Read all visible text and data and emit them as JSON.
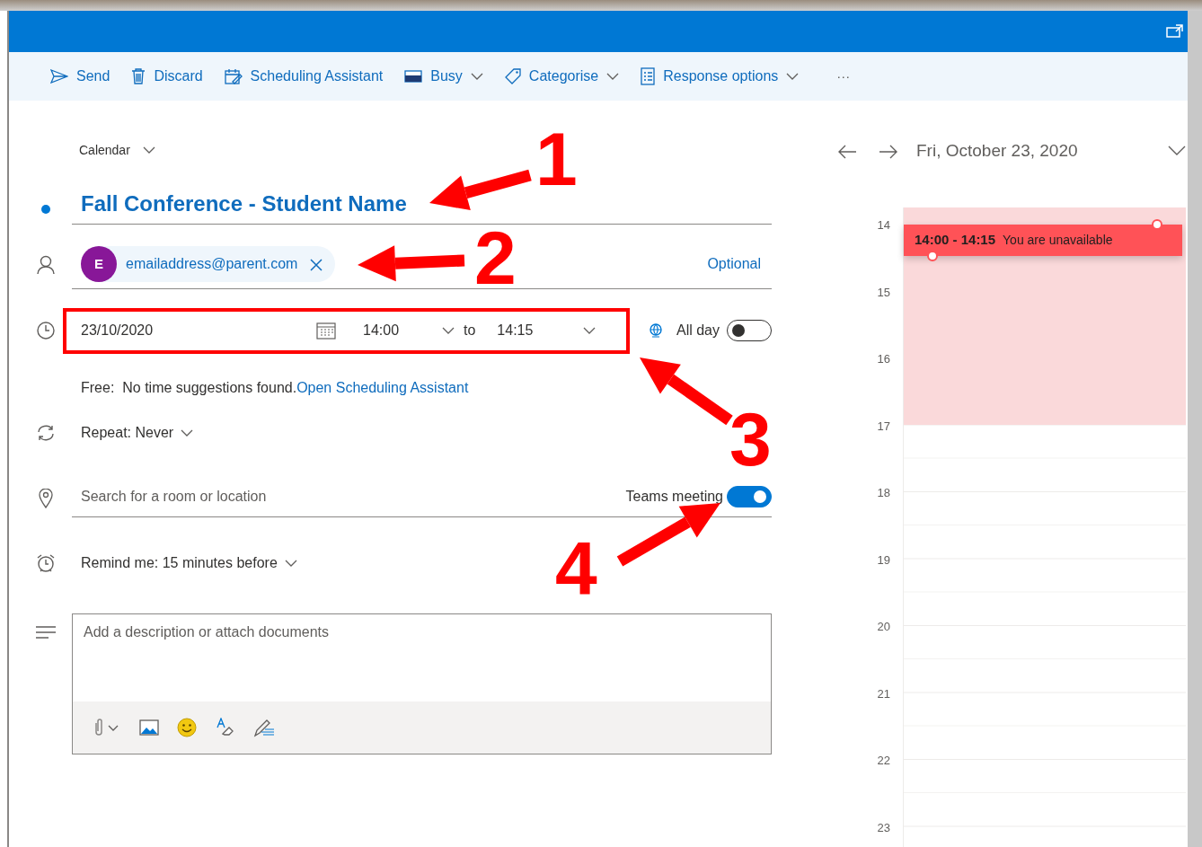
{
  "toolbar": {
    "items": [
      {
        "label": "Send",
        "kind": "send"
      },
      {
        "label": "Discard",
        "kind": "discard"
      },
      {
        "label": "Scheduling Assistant",
        "kind": "schedule"
      },
      {
        "label": "Busy",
        "kind": "busy"
      },
      {
        "label": "Categorise",
        "kind": "tag"
      },
      {
        "label": "Response options",
        "kind": "response"
      }
    ],
    "more": "···"
  },
  "form": {
    "calendar": "Calendar",
    "title": "Fall Conference - Student Name",
    "attendee": {
      "initial": "E",
      "email": "emailaddress@parent.com"
    },
    "optional": "Optional",
    "date": "23/10/2020",
    "start": "14:00",
    "to": "to",
    "end": "14:15",
    "all_day": {
      "label": "All day",
      "on": false
    },
    "free_label": "Free:",
    "free_text": "No time suggestions found.",
    "free_link": "Open Scheduling Assistant",
    "repeat": {
      "label": "Repeat:",
      "value": "Never"
    },
    "location": {
      "placeholder": "Search for a room or location"
    },
    "teams": {
      "label": "Teams meeting",
      "on": true
    },
    "remind": {
      "label": "Remind me:",
      "value": "15 minutes before"
    },
    "description": {
      "placeholder": "Add a description or attach documents"
    }
  },
  "calendar": {
    "date": "Fri, October 23, 2020",
    "hours": [
      "14",
      "15",
      "16",
      "17",
      "18",
      "19",
      "20",
      "21",
      "22",
      "23"
    ],
    "event": {
      "time": "14:00 - 14:15",
      "text": "You are unavailable"
    }
  },
  "annotations": [
    {
      "label": "1"
    },
    {
      "label": "2"
    },
    {
      "label": "3"
    },
    {
      "label": "4"
    }
  ]
}
